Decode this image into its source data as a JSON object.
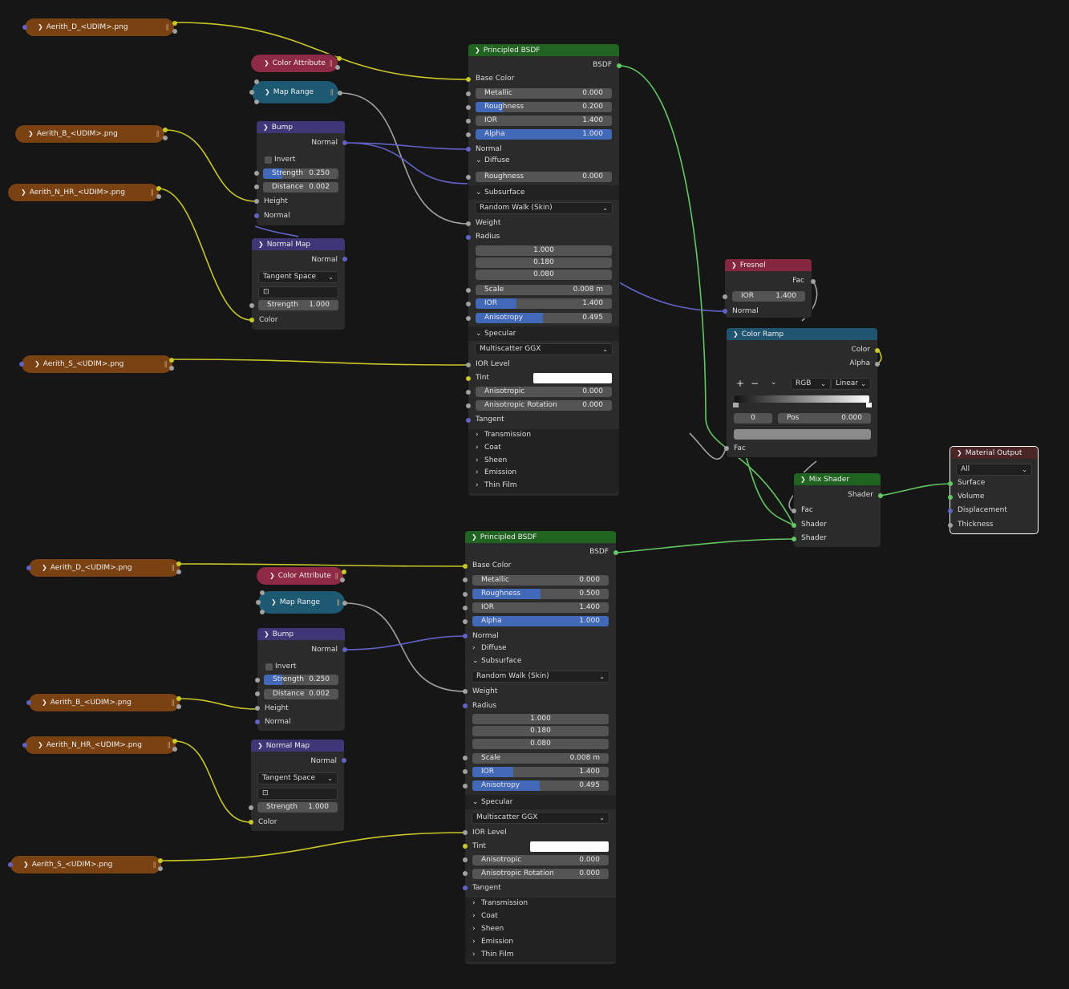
{
  "top": {
    "textures": {
      "diffuse": "Aerith_D_<UDIM>.png",
      "bump": "Aerith_B_<UDIM>.png",
      "normal": "Aerith_N_HR_<UDIM>.png",
      "specular": "Aerith_S_<UDIM>.png"
    },
    "color_attribute": "Color Attribute",
    "map_range": "Map Range",
    "bump": {
      "title": "Bump",
      "out_normal": "Normal",
      "invert": "Invert",
      "strength_label": "Strength",
      "strength": "0.250",
      "strength_fill": 0.25,
      "distance_label": "Distance",
      "distance": "0.002",
      "height": "Height",
      "normal": "Normal"
    },
    "normal_map": {
      "title": "Normal Map",
      "out_normal": "Normal",
      "space": "Tangent Space",
      "strength_label": "Strength",
      "strength": "1.000",
      "color": "Color"
    },
    "bsdf": {
      "title": "Principled BSDF",
      "output": "BSDF",
      "base_color": "Base Color",
      "metallic_label": "Metallic",
      "metallic": "0.000",
      "metallic_fill": 0,
      "roughness_label": "Roughness",
      "roughness": "0.200",
      "roughness_fill": 0.2,
      "ior_label": "IOR",
      "ior": "1.400",
      "alpha_label": "Alpha",
      "alpha": "1.000",
      "alpha_fill": 1,
      "normal": "Normal",
      "diffuse": "Diffuse",
      "diffuse_roughness_label": "Roughness",
      "diffuse_roughness": "0.000",
      "subsurface": "Subsurface",
      "method": "Random Walk (Skin)",
      "weight": "Weight",
      "radius": "Radius",
      "radius_values": [
        "1.000",
        "0.180",
        "0.080"
      ],
      "scale_label": "Scale",
      "scale": "0.008 m",
      "ss_ior_label": "IOR",
      "ss_ior": "1.400",
      "anisotropy_label": "Anisotropy",
      "anisotropy": "0.495",
      "anisotropy_fill": 0.495,
      "specular": "Specular",
      "distribution": "Multiscatter GGX",
      "ior_level": "IOR Level",
      "tint": "Tint",
      "anisotropic_label": "Anisotropic",
      "anisotropic": "0.000",
      "aniso_rot_label": "Anisotropic Rotation",
      "aniso_rot": "0.000",
      "tangent": "Tangent",
      "panels": [
        "Transmission",
        "Coat",
        "Sheen",
        "Emission",
        "Thin Film"
      ]
    }
  },
  "bottom": {
    "textures": {
      "diffuse": "Aerith_D_<UDIM>.png",
      "bump": "Aerith_B_<UDIM>.png",
      "normal": "Aerith_N_HR_<UDIM>.png",
      "specular": "Aerith_S_<UDIM>.png"
    },
    "color_attribute": "Color Attribute",
    "map_range": "Map Range",
    "bump": {
      "title": "Bump",
      "out_normal": "Normal",
      "invert": "Invert",
      "strength_label": "Strength",
      "strength": "0.250",
      "strength_fill": 0.25,
      "distance_label": "Distance",
      "distance": "0.002",
      "height": "Height",
      "normal": "Normal"
    },
    "normal_map": {
      "title": "Normal Map",
      "out_normal": "Normal",
      "space": "Tangent Space",
      "strength_label": "Strength",
      "strength": "1.000",
      "color": "Color"
    },
    "bsdf": {
      "title": "Principled BSDF",
      "output": "BSDF",
      "base_color": "Base Color",
      "metallic_label": "Metallic",
      "metallic": "0.000",
      "metallic_fill": 0,
      "roughness_label": "Roughness",
      "roughness": "0.500",
      "roughness_fill": 0.5,
      "ior_label": "IOR",
      "ior": "1.400",
      "alpha_label": "Alpha",
      "alpha": "1.000",
      "alpha_fill": 1,
      "normal": "Normal",
      "diffuse": "Diffuse",
      "subsurface": "Subsurface",
      "method": "Random Walk (Skin)",
      "weight": "Weight",
      "radius": "Radius",
      "radius_values": [
        "1.000",
        "0.180",
        "0.080"
      ],
      "scale_label": "Scale",
      "scale": "0.008 m",
      "ss_ior_label": "IOR",
      "ss_ior": "1.400",
      "anisotropy_label": "Anisotropy",
      "anisotropy": "0.495",
      "anisotropy_fill": 0.495,
      "specular": "Specular",
      "distribution": "Multiscatter GGX",
      "ior_level": "IOR Level",
      "tint": "Tint",
      "anisotropic_label": "Anisotropic",
      "anisotropic": "0.000",
      "aniso_rot_label": "Anisotropic Rotation",
      "aniso_rot": "0.000",
      "tangent": "Tangent",
      "panels": [
        "Transmission",
        "Coat",
        "Sheen",
        "Emission",
        "Thin Film"
      ]
    }
  },
  "fresnel": {
    "title": "Fresnel",
    "fac": "Fac",
    "ior_label": "IOR",
    "ior": "1.400",
    "normal": "Normal"
  },
  "color_ramp": {
    "title": "Color Ramp",
    "color": "Color",
    "alpha": "Alpha",
    "plus": "+",
    "minus": "−",
    "mode": "RGB",
    "interp": "Linear",
    "index": "0",
    "pos_label": "Pos",
    "pos": "0.000",
    "fac": "Fac"
  },
  "mix_shader": {
    "title": "Mix Shader",
    "out": "Shader",
    "fac": "Fac",
    "shader1": "Shader",
    "shader2": "Shader"
  },
  "material_output": {
    "title": "Material Output",
    "target": "All",
    "surface": "Surface",
    "volume": "Volume",
    "displacement": "Displacement",
    "thickness": "Thickness"
  },
  "colors": {
    "background": "#161616",
    "node_body": "#2b2b2b",
    "texture_node": "#7a4213",
    "attribute_node": "#8e2a45",
    "converter_node": "#1d5a72",
    "vector_node": "#3d3777",
    "shader_node": "#216321",
    "color_socket": "#c7c729",
    "float_socket": "#a1a1a1",
    "vector_socket": "#6363c7",
    "shader_socket": "#63c763",
    "slider_fill": "#4269b8"
  }
}
